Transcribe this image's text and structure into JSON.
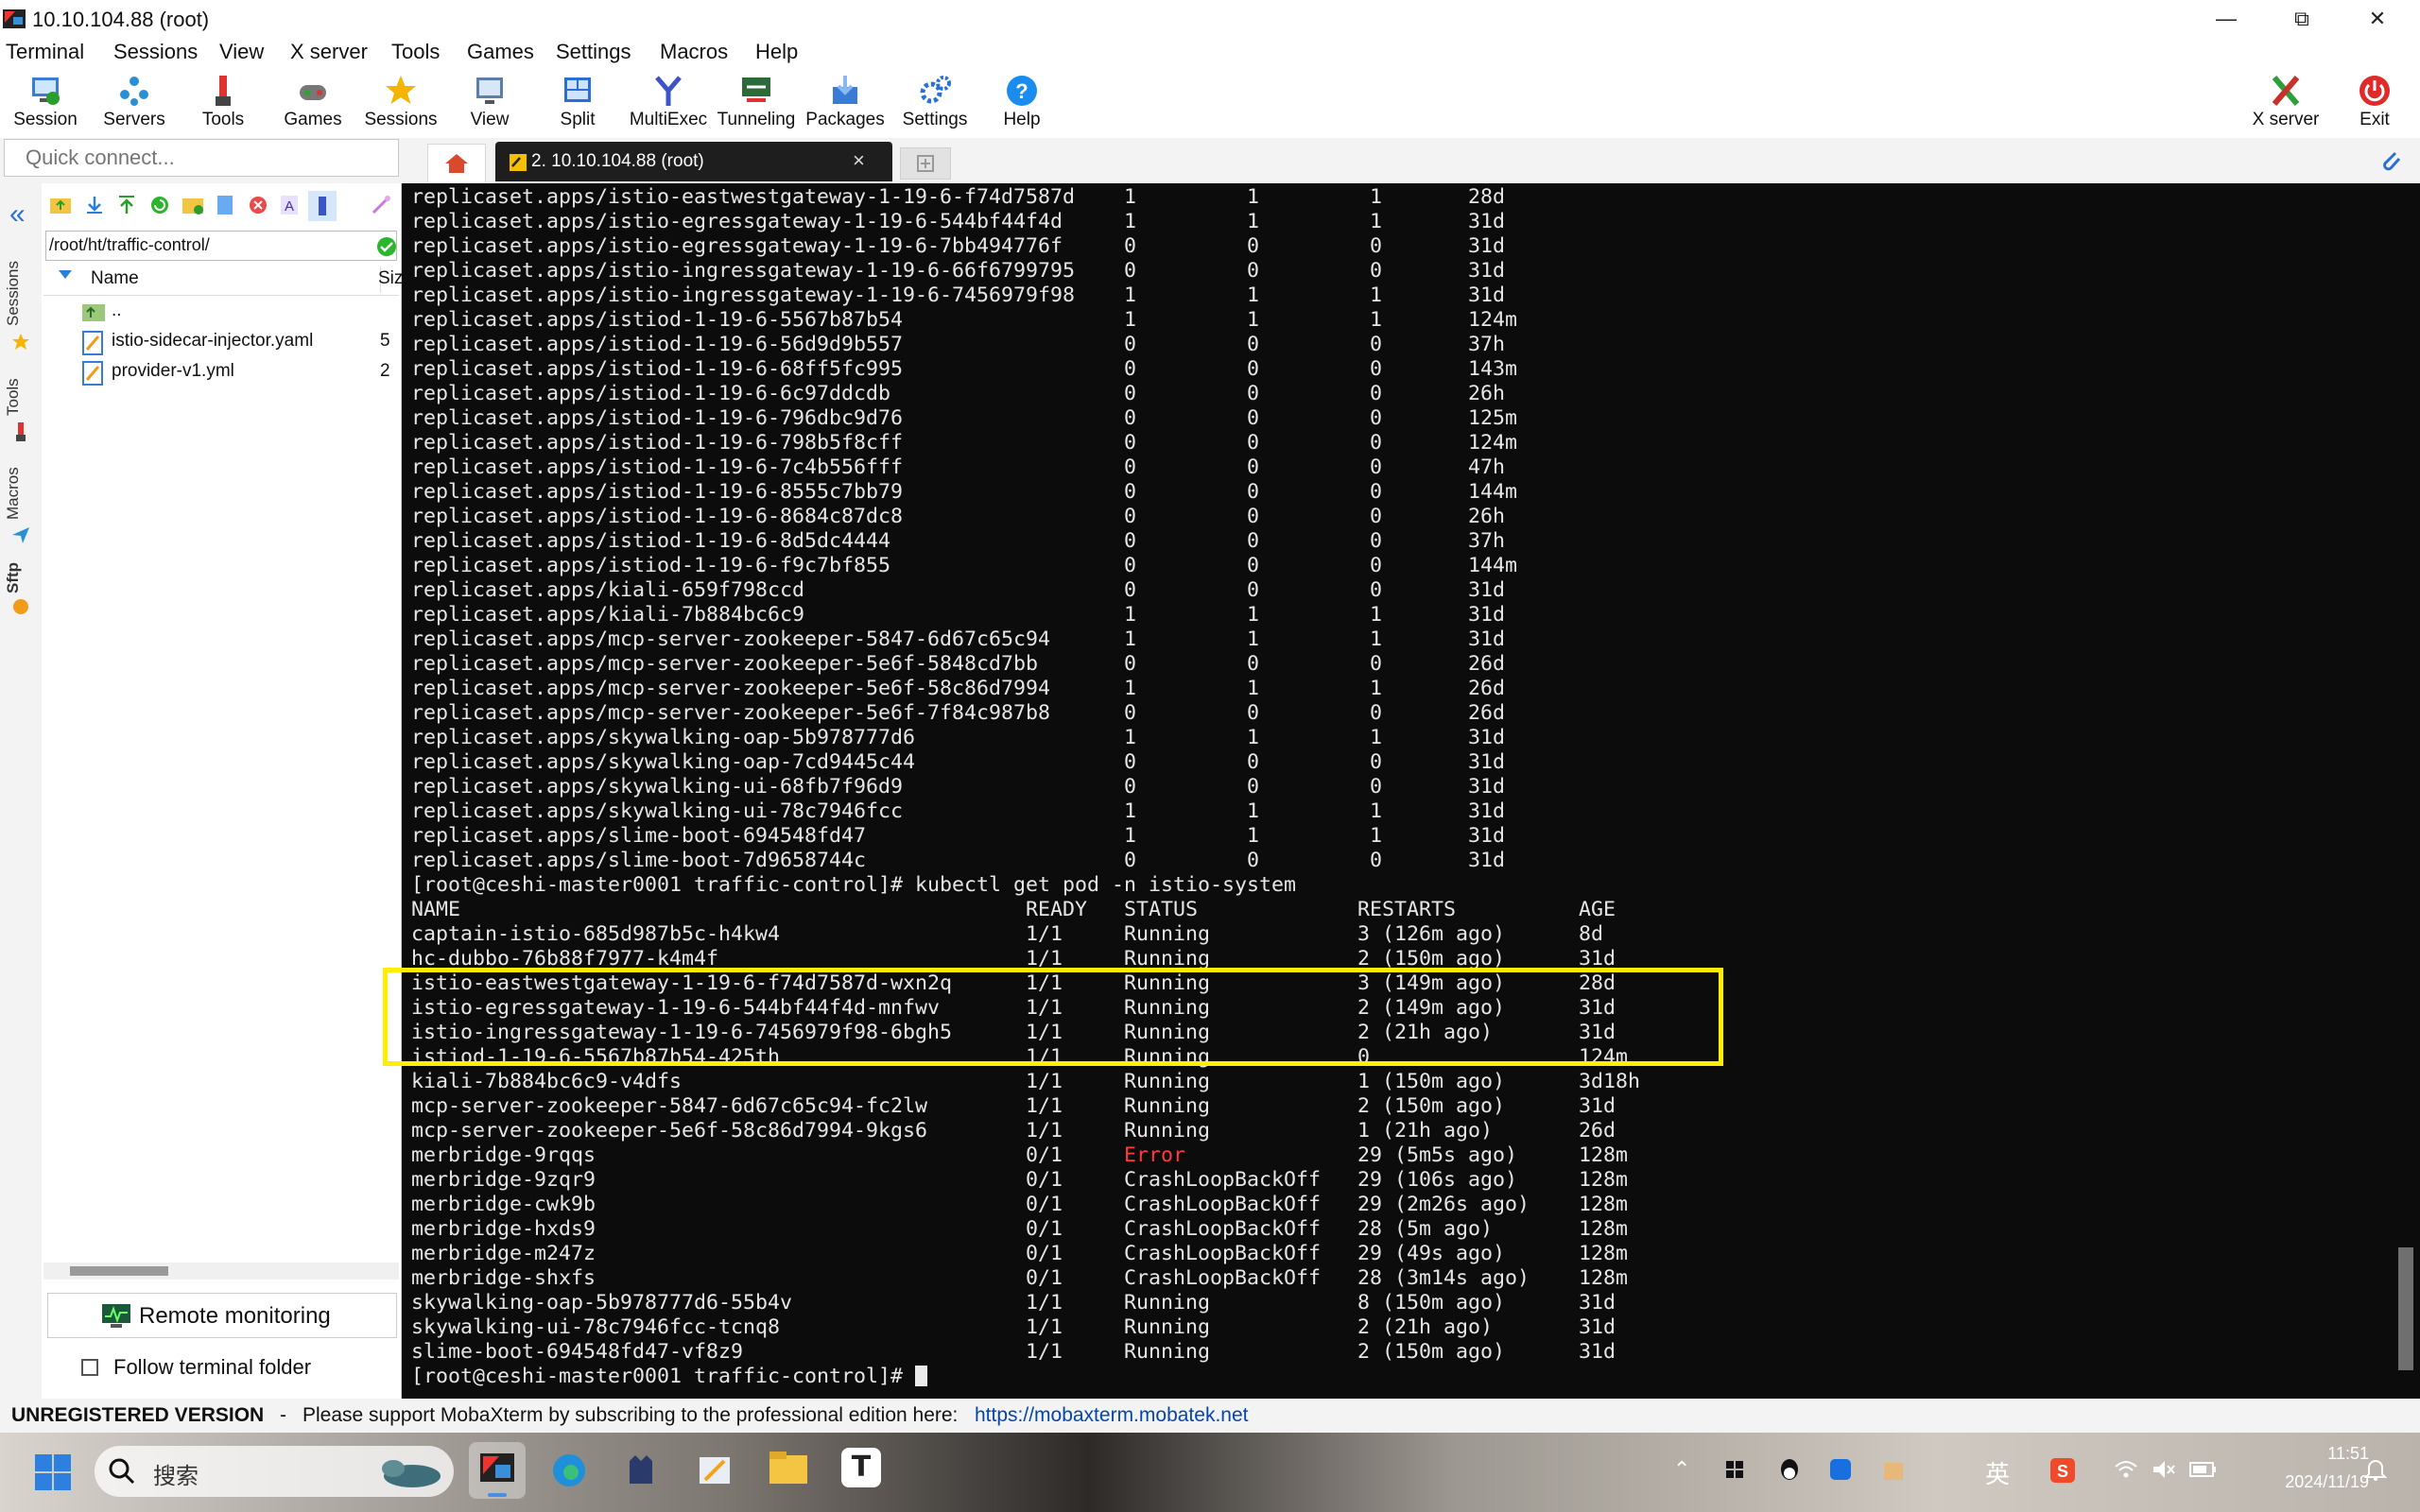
{
  "window": {
    "title": "10.10.104.88 (root)"
  },
  "menu": [
    "Terminal",
    "Sessions",
    "View",
    "X server",
    "Tools",
    "Games",
    "Settings",
    "Macros",
    "Help"
  ],
  "toolbar": {
    "buttons": [
      "Session",
      "Servers",
      "Tools",
      "Games",
      "Sessions",
      "View",
      "Split",
      "MultiExec",
      "Tunneling",
      "Packages",
      "Settings",
      "Help"
    ],
    "right_buttons": [
      "X server",
      "Exit"
    ]
  },
  "quick_connect": {
    "placeholder": "Quick connect..."
  },
  "tabs": [
    {
      "label": "2. 10.10.104.88 (root)"
    }
  ],
  "side_tabs": [
    "Sessions",
    "Tools",
    "Macros",
    "Sftp"
  ],
  "sftp": {
    "path": "/root/ht/traffic-control/",
    "columns": [
      "Name",
      "Siz"
    ],
    "files": [
      {
        "name": "..",
        "size": ""
      },
      {
        "name": "istio-sidecar-injector.yaml",
        "size": "5"
      },
      {
        "name": "provider-v1.yml",
        "size": "2"
      }
    ],
    "remote_monitoring": "Remote monitoring",
    "follow_terminal": "Follow terminal folder"
  },
  "terminal": {
    "lines": [
      "replicaset.apps/istio-eastwestgateway-1-19-6-f74d7587d    1         1         1       28d",
      "replicaset.apps/istio-egressgateway-1-19-6-544bf44f4d     1         1         1       31d",
      "replicaset.apps/istio-egressgateway-1-19-6-7bb494776f     0         0         0       31d",
      "replicaset.apps/istio-ingressgateway-1-19-6-66f6799795    0         0         0       31d",
      "replicaset.apps/istio-ingressgateway-1-19-6-7456979f98    1         1         1       31d",
      "replicaset.apps/istiod-1-19-6-5567b87b54                  1         1         1       124m",
      "replicaset.apps/istiod-1-19-6-56d9d9b557                  0         0         0       37h",
      "replicaset.apps/istiod-1-19-6-68ff5fc995                  0         0         0       143m",
      "replicaset.apps/istiod-1-19-6-6c97ddcdb                   0         0         0       26h",
      "replicaset.apps/istiod-1-19-6-796dbc9d76                  0         0         0       125m",
      "replicaset.apps/istiod-1-19-6-798b5f8cff                  0         0         0       124m",
      "replicaset.apps/istiod-1-19-6-7c4b556fff                  0         0         0       47h",
      "replicaset.apps/istiod-1-19-6-8555c7bb79                  0         0         0       144m",
      "replicaset.apps/istiod-1-19-6-8684c87dc8                  0         0         0       26h",
      "replicaset.apps/istiod-1-19-6-8d5dc4444                   0         0         0       37h",
      "replicaset.apps/istiod-1-19-6-f9c7bf855                   0         0         0       144m",
      "replicaset.apps/kiali-659f798ccd                          0         0         0       31d",
      "replicaset.apps/kiali-7b884bc6c9                          1         1         1       31d",
      "replicaset.apps/mcp-server-zookeeper-5847-6d67c65c94      1         1         1       31d",
      "replicaset.apps/mcp-server-zookeeper-5e6f-5848cd7bb       0         0         0       26d",
      "replicaset.apps/mcp-server-zookeeper-5e6f-58c86d7994      1         1         1       26d",
      "replicaset.apps/mcp-server-zookeeper-5e6f-7f84c987b8      0         0         0       26d",
      "replicaset.apps/skywalking-oap-5b978777d6                 1         1         1       31d",
      "replicaset.apps/skywalking-oap-7cd9445c44                 0         0         0       31d",
      "replicaset.apps/skywalking-ui-68fb7f96d9                  0         0         0       31d",
      "replicaset.apps/skywalking-ui-78c7946fcc                  1         1         1       31d",
      "replicaset.apps/slime-boot-694548fd47                     1         1         1       31d",
      "replicaset.apps/slime-boot-7d9658744c                     0         0         0       31d",
      "[root@ceshi-master0001 traffic-control]# kubectl get pod -n istio-system",
      "NAME                                              READY   STATUS             RESTARTS          AGE",
      "captain-istio-685d987b5c-h4kw4                    1/1     Running            3 (126m ago)      8d",
      "hc-dubbo-76b88f7977-k4m4f                         1/1     Running            2 (150m ago)      31d",
      "istio-eastwestgateway-1-19-6-f74d7587d-wxn2q      1/1     Running            3 (149m ago)      28d",
      "istio-egressgateway-1-19-6-544bf44f4d-mnfwv       1/1     Running            2 (149m ago)      31d",
      "istio-ingressgateway-1-19-6-7456979f98-6bgh5      1/1     Running            2 (21h ago)       31d",
      "istiod-1-19-6-5567b87b54-425th                    1/1     Running            0                 124m",
      "kiali-7b884bc6c9-v4dfs                            1/1     Running            1 (150m ago)      3d18h",
      "mcp-server-zookeeper-5847-6d67c65c94-fc2lw        1/1     Running            2 (150m ago)      31d",
      "mcp-server-zookeeper-5e6f-58c86d7994-9kgs6        1/1     Running            1 (21h ago)       26d"
    ],
    "merbridge": [
      {
        "name": "merbridge-9rqqs",
        "ready": "0/1",
        "status": "Error",
        "restarts": "29 (5m5s ago)",
        "age": "128m"
      },
      {
        "name": "merbridge-9zqr9",
        "ready": "0/1",
        "status": "CrashLoopBackOff",
        "restarts": "29 (106s ago)",
        "age": "128m"
      },
      {
        "name": "merbridge-cwk9b",
        "ready": "0/1",
        "status": "CrashLoopBackOff",
        "restarts": "29 (2m26s ago)",
        "age": "128m"
      },
      {
        "name": "merbridge-hxds9",
        "ready": "0/1",
        "status": "CrashLoopBackOff",
        "restarts": "28 (5m ago)",
        "age": "128m"
      },
      {
        "name": "merbridge-m247z",
        "ready": "0/1",
        "status": "CrashLoopBackOff",
        "restarts": "29 (49s ago)",
        "age": "128m"
      },
      {
        "name": "merbridge-shxfs",
        "ready": "0/1",
        "status": "CrashLoopBackOff",
        "restarts": "28 (3m14s ago)",
        "age": "128m"
      }
    ],
    "tail": [
      "skywalking-oap-5b978777d6-55b4v                   1/1     Running            8 (150m ago)      31d",
      "skywalking-ui-78c7946fcc-tcnq8                    1/1     Running            2 (21h ago)       31d",
      "slime-boot-694548fd47-vf8z9                       1/1     Running            2 (150m ago)      31d"
    ],
    "prompt": "[root@ceshi-master0001 traffic-control]# "
  },
  "status": {
    "unregistered": "UNREGISTERED VERSION",
    "dash": "-",
    "message": "Please support MobaXterm by subscribing to the professional edition here:",
    "link": "https://mobaxterm.mobatek.net"
  },
  "taskbar": {
    "search": "搜索",
    "ime": "英",
    "time": "11:51",
    "date": "2024/11/19"
  },
  "colors": {
    "highlight": "#ffee00",
    "error": "#ff3b3b",
    "link": "#0645ad"
  }
}
